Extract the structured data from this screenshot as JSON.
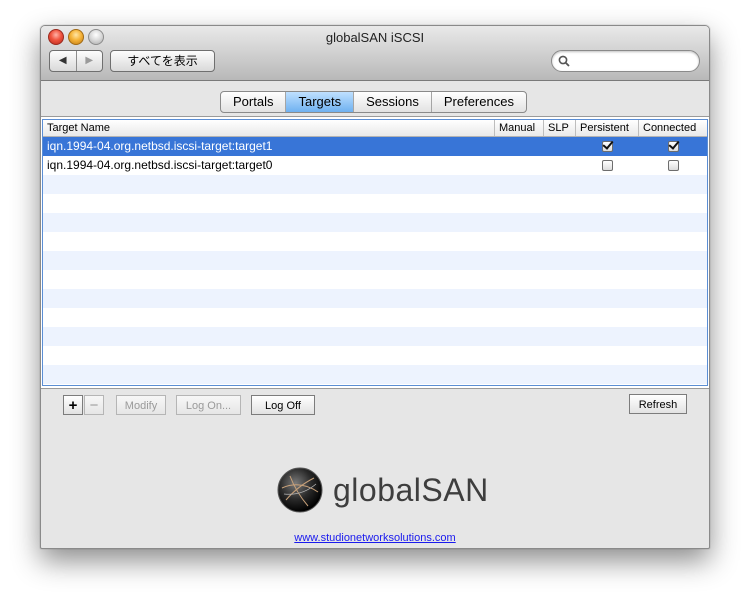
{
  "window": {
    "title": "globalSAN iSCSI",
    "toolbar": {
      "back_label": "◀",
      "forward_label": "▶",
      "show_all_label": "すべてを表示",
      "search_placeholder": ""
    }
  },
  "tabs": [
    {
      "label": "Portals",
      "active": false
    },
    {
      "label": "Targets",
      "active": true
    },
    {
      "label": "Sessions",
      "active": false
    },
    {
      "label": "Preferences",
      "active": false
    }
  ],
  "table": {
    "columns": [
      "Target Name",
      "Manual",
      "SLP",
      "Persistent",
      "Connected"
    ],
    "rows": [
      {
        "name": "iqn.1994-04.org.netbsd.iscsi-target:target1",
        "manual": false,
        "slp": false,
        "persistent": true,
        "connected": true,
        "selected": true
      },
      {
        "name": "iqn.1994-04.org.netbsd.iscsi-target:target0",
        "manual": false,
        "slp": false,
        "persistent": false,
        "connected": false,
        "selected": false
      }
    ]
  },
  "buttons": {
    "add_label": "+",
    "remove_label": "−",
    "modify_label": "Modify",
    "log_on_label": "Log On...",
    "log_off_label": "Log Off",
    "refresh_label": "Refresh"
  },
  "brand": {
    "logo_text": "globalSAN",
    "link_text": "www.studionetworksolutions.com"
  },
  "colors": {
    "selection": "#3875d7",
    "alt_row": "#edf3fe",
    "active_tab": "#6fb1f0",
    "link": "#1a1aee"
  }
}
